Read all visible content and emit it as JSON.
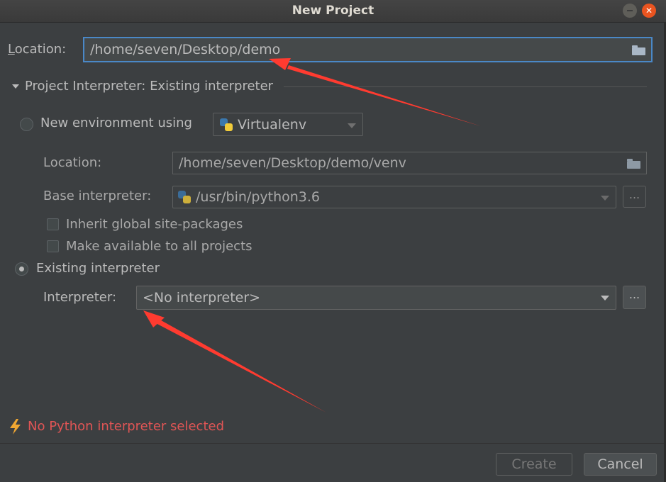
{
  "window": {
    "title": "New Project"
  },
  "location": {
    "label_prefix": "L",
    "label_rest": "ocation:",
    "value": "/home/seven/Desktop/demo"
  },
  "section": {
    "title": "Project Interpreter: Existing interpreter"
  },
  "new_env": {
    "radio_label": "New environment using",
    "tool": "Virtualenv",
    "location_label": "Location:",
    "location_value": "/home/seven/Desktop/demo/venv",
    "base_label": "Base interpreter:",
    "base_value": "/usr/bin/python3.6",
    "ellipsis": "...",
    "inherit_label": "Inherit global site-packages",
    "make_available_label": "Make available to all projects"
  },
  "existing": {
    "radio_label": "Existing interpreter",
    "interpreter_label": "Interpreter:",
    "interpreter_value": "<No interpreter>",
    "ellipsis": "..."
  },
  "status": {
    "error": "No Python interpreter selected",
    "error_color": "#e05555"
  },
  "buttons": {
    "create": "Create",
    "cancel": "Cancel"
  },
  "annotation": {
    "arrow_color": "#ff3b30"
  },
  "icons": [
    "close-icon",
    "minimize-icon",
    "folder-icon",
    "python-icon",
    "chevron-down-icon",
    "lightning-icon"
  ]
}
